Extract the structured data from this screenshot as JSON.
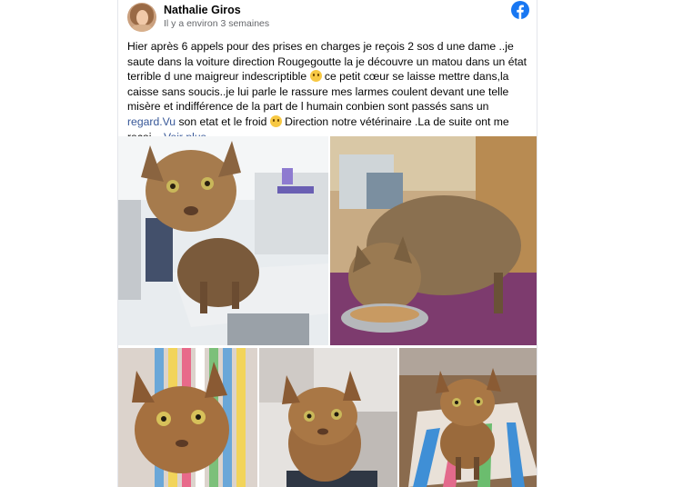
{
  "post": {
    "author": "Nathalie Giros",
    "timestamp": "Il y a environ 3 semaines",
    "text_1": "Hier après 6 appels pour des prises en charges je reçois 2 sos d une dame ..je saute dans la voiture direction Rougegoutte la je découvre un matou dans un état terrible d une maigreur indescriptible ",
    "text_2": " ce petit cœur se laisse mettre dans,la caisse sans soucis..je lui parle le rassure mes larmes coulent devant une telle misère et indifférence de la part de l humain conbien sont passés sans un ",
    "link_text": "regard.Vu",
    "text_3": " son etat et le froid ",
    "text_4": " Direction notre vétérinaire .La de suite ont me reçoi... ",
    "see_more": "Voir plus"
  },
  "icons": {
    "platform": "facebook-icon",
    "emoji": "sad-face-emoji"
  },
  "colors": {
    "link": "#385898",
    "facebook_blue": "#1877f2",
    "meta_text": "#65676b"
  },
  "photos": [
    {
      "subject": "cat on vet table"
    },
    {
      "subject": "cat eating from bowl"
    },
    {
      "subject": "cat on striped blanket close-up"
    },
    {
      "subject": "cat sitting near wall"
    },
    {
      "subject": "cat standing on rug"
    }
  ]
}
